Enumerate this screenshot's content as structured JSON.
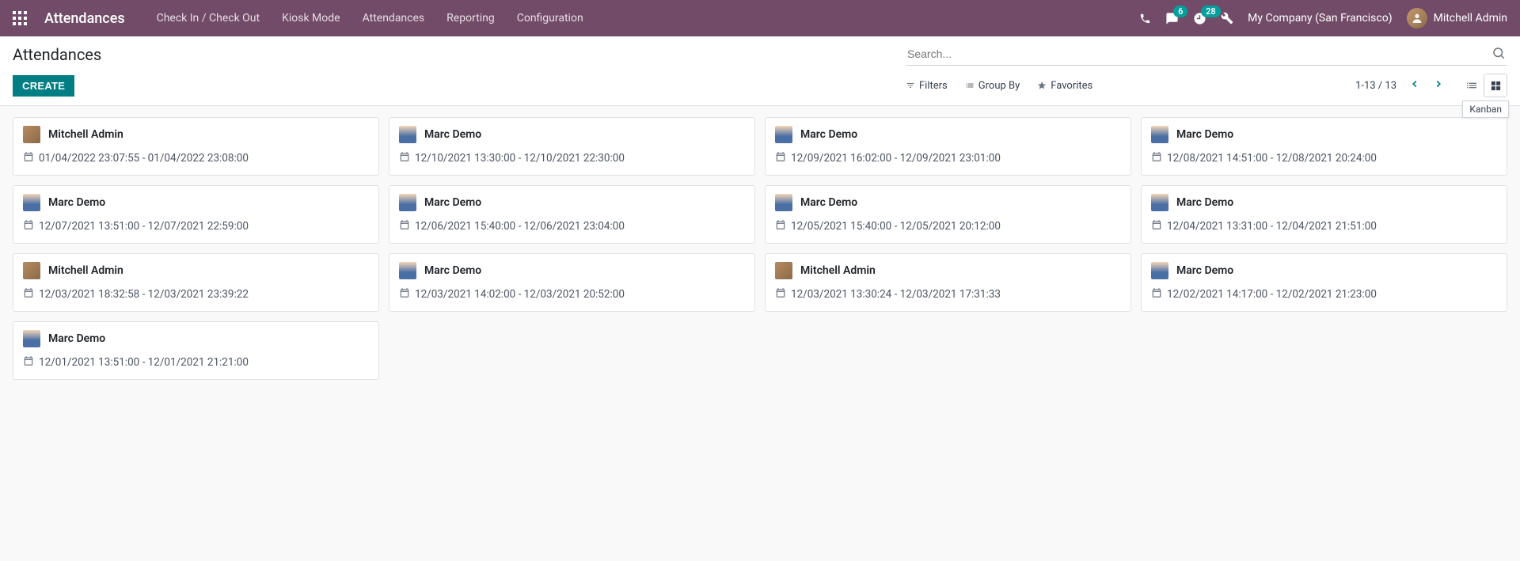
{
  "header": {
    "app_title": "Attendances",
    "nav": [
      "Check In / Check Out",
      "Kiosk Mode",
      "Attendances",
      "Reporting",
      "Configuration"
    ],
    "messages_badge": "6",
    "activities_badge": "28",
    "company": "My Company (San Francisco)",
    "user": "Mitchell Admin"
  },
  "control_panel": {
    "breadcrumb": "Attendances",
    "create_label": "CREATE",
    "search_placeholder": "Search...",
    "filters_label": "Filters",
    "groupby_label": "Group By",
    "favorites_label": "Favorites",
    "pager": "1-13 / 13",
    "tooltip": "Kanban"
  },
  "records": [
    {
      "employee": "Mitchell Admin",
      "avatar": "mitchell",
      "range": "01/04/2022 23:07:55 - 01/04/2022 23:08:00"
    },
    {
      "employee": "Marc Demo",
      "avatar": "marc",
      "range": "12/10/2021 13:30:00 - 12/10/2021 22:30:00"
    },
    {
      "employee": "Marc Demo",
      "avatar": "marc",
      "range": "12/09/2021 16:02:00 - 12/09/2021 23:01:00"
    },
    {
      "employee": "Marc Demo",
      "avatar": "marc",
      "range": "12/08/2021 14:51:00 - 12/08/2021 20:24:00"
    },
    {
      "employee": "Marc Demo",
      "avatar": "marc",
      "range": "12/07/2021 13:51:00 - 12/07/2021 22:59:00"
    },
    {
      "employee": "Marc Demo",
      "avatar": "marc",
      "range": "12/06/2021 15:40:00 - 12/06/2021 23:04:00"
    },
    {
      "employee": "Marc Demo",
      "avatar": "marc",
      "range": "12/05/2021 15:40:00 - 12/05/2021 20:12:00"
    },
    {
      "employee": "Marc Demo",
      "avatar": "marc",
      "range": "12/04/2021 13:31:00 - 12/04/2021 21:51:00"
    },
    {
      "employee": "Mitchell Admin",
      "avatar": "mitchell",
      "range": "12/03/2021 18:32:58 - 12/03/2021 23:39:22"
    },
    {
      "employee": "Marc Demo",
      "avatar": "marc",
      "range": "12/03/2021 14:02:00 - 12/03/2021 20:52:00"
    },
    {
      "employee": "Mitchell Admin",
      "avatar": "mitchell",
      "range": "12/03/2021 13:30:24 - 12/03/2021 17:31:33"
    },
    {
      "employee": "Marc Demo",
      "avatar": "marc",
      "range": "12/02/2021 14:17:00 - 12/02/2021 21:23:00"
    },
    {
      "employee": "Marc Demo",
      "avatar": "marc",
      "range": "12/01/2021 13:51:00 - 12/01/2021 21:21:00"
    }
  ]
}
